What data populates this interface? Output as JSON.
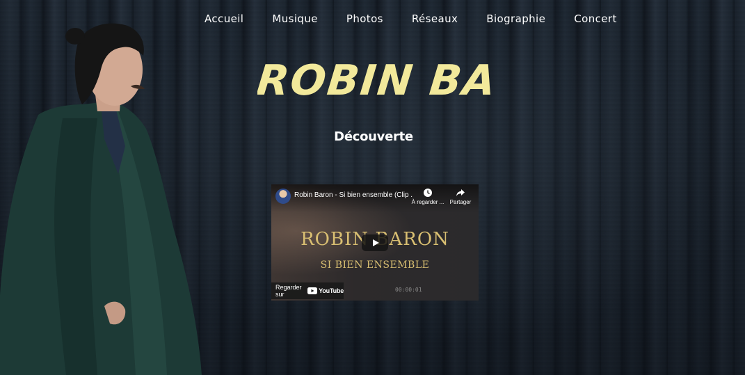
{
  "nav": {
    "items": [
      {
        "label": "Accueil"
      },
      {
        "label": "Musique"
      },
      {
        "label": "Photos"
      },
      {
        "label": "Réseaux"
      },
      {
        "label": "Biographie"
      },
      {
        "label": "Concert"
      }
    ]
  },
  "hero": {
    "logo_text": "ROBIN BARON",
    "section_title": "Découverte"
  },
  "video": {
    "title": "Robin Baron - Si bien ensemble (Clip ...",
    "watch_later_label": "À regarder ...",
    "share_label": "Partager",
    "artist_text": "ROBIN BARON",
    "song_text": "SI BIEN ENSEMBLE",
    "watch_on_label": "Regarder sur",
    "youtube_label": "YouTube",
    "timecode": "00:00:01"
  },
  "colors": {
    "logo": "#f2e99b",
    "video_gold": "#d9bf72",
    "youtube_red": "#ff0000",
    "background": "#1f2833"
  },
  "icons": {
    "watch_later": "clock-icon",
    "share": "share-icon",
    "play": "play-icon",
    "youtube": "youtube-icon"
  }
}
